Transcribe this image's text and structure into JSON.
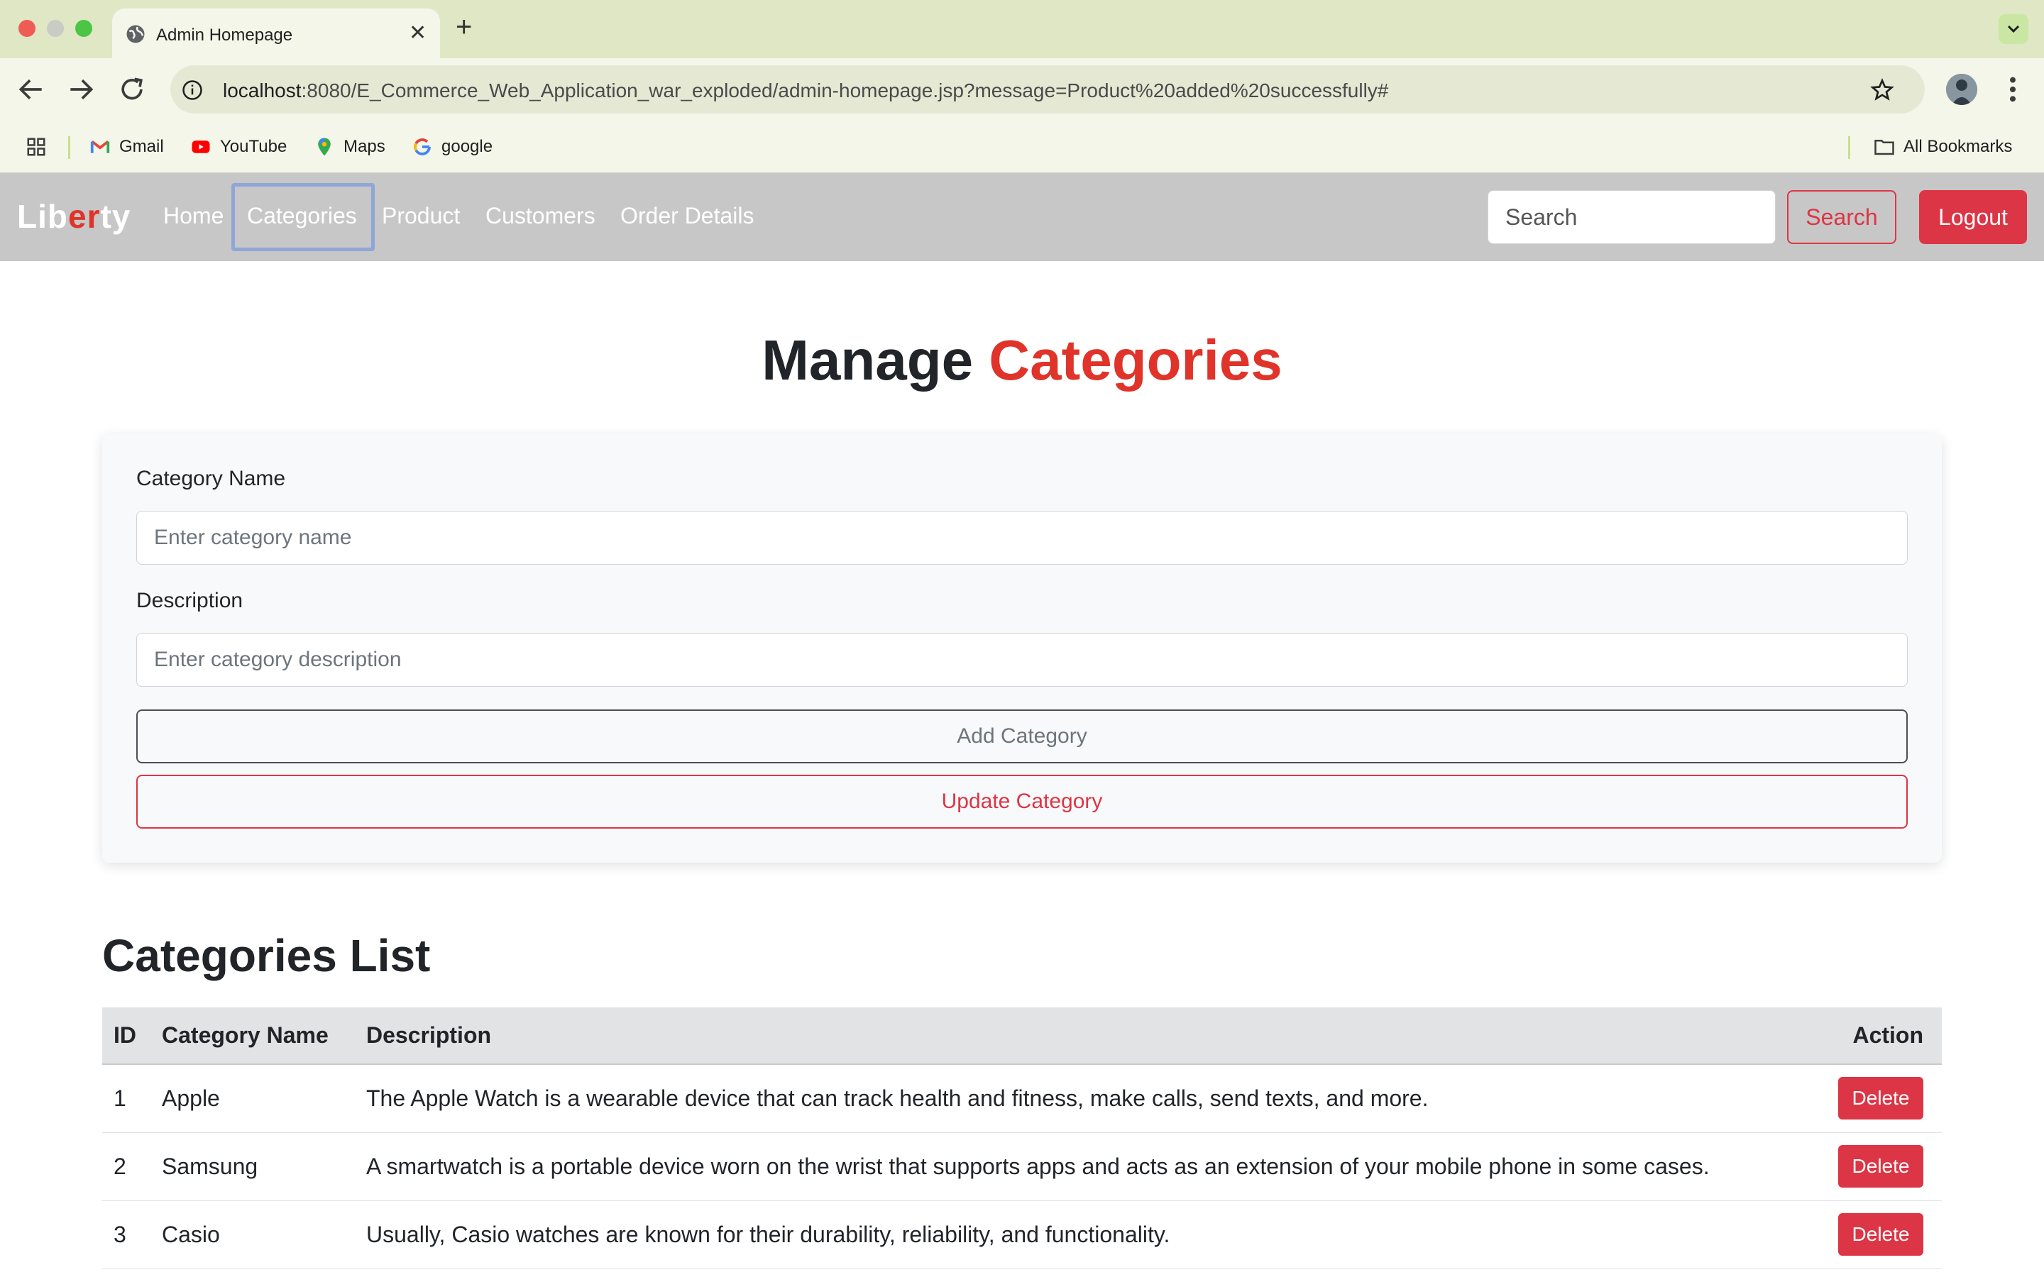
{
  "browser": {
    "tab_title": "Admin Homepage",
    "url_host": "localhost",
    "url_rest": ":8080/E_Commerce_Web_Application_war_exploded/admin-homepage.jsp?message=Product%20added%20successfully#",
    "bookmarks": [
      "Gmail",
      "YouTube",
      "Maps",
      "google"
    ],
    "all_bookmarks": "All Bookmarks"
  },
  "navbar": {
    "brand_a": "Lib",
    "brand_b": "er",
    "brand_c": "ty",
    "links": [
      "Home",
      "Categories",
      "Product",
      "Customers",
      "Order Details"
    ],
    "search_placeholder": "Search",
    "search_button": "Search",
    "logout_button": "Logout"
  },
  "page": {
    "heading_a": "Manage",
    "heading_b": "Categories",
    "accent_color": "#e0332a"
  },
  "form": {
    "name_label": "Category Name",
    "name_placeholder": "Enter category name",
    "desc_label": "Description",
    "desc_placeholder": "Enter category description",
    "add_button": "Add Category",
    "update_button": "Update Category"
  },
  "list": {
    "title": "Categories List",
    "columns": [
      "ID",
      "Category Name",
      "Description",
      "Action"
    ],
    "rows": [
      {
        "id": "1",
        "name": "Apple",
        "description": "The Apple Watch is a wearable device that can track health and fitness, make calls, send texts, and more.",
        "action": "Delete"
      },
      {
        "id": "2",
        "name": "Samsung",
        "description": "A smartwatch is a portable device worn on the wrist that supports apps and acts as an extension of your mobile phone in some cases.",
        "action": "Delete"
      },
      {
        "id": "3",
        "name": "Casio",
        "description": "Usually, Casio watches are known for their durability, reliability, and functionality.",
        "action": "Delete"
      }
    ]
  }
}
